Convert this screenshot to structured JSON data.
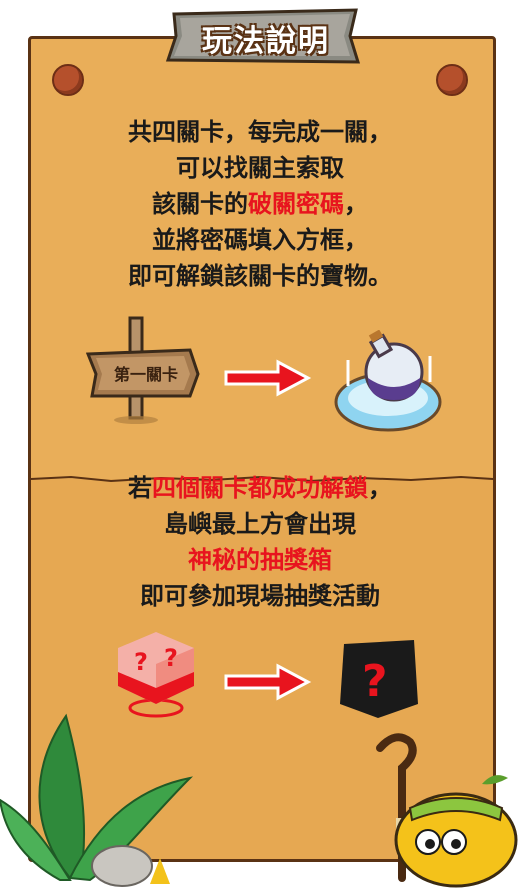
{
  "title": "玩法說明",
  "intro": {
    "line1": "共四關卡，每完成一關，",
    "line2": "可以找關主索取",
    "line3_pre": "該關卡的",
    "line3_red": "破關密碼",
    "line3_post": "，",
    "line4": "並將密碼填入方框，",
    "line5": "即可解鎖該關卡的寶物。"
  },
  "sign_label": "第一關卡",
  "bonus": {
    "line1_pre": "若",
    "line1_red": "四個關卡都成功解鎖",
    "line1_post": "，",
    "line2": "島嶼最上方會出現",
    "line3_red": "神秘的抽獎箱",
    "line4": "即可參加現場抽獎活動"
  },
  "colors": {
    "board": "#e9ae59",
    "border": "#5a3214",
    "highlight": "#e8141e",
    "arrow": "#e8141e"
  }
}
